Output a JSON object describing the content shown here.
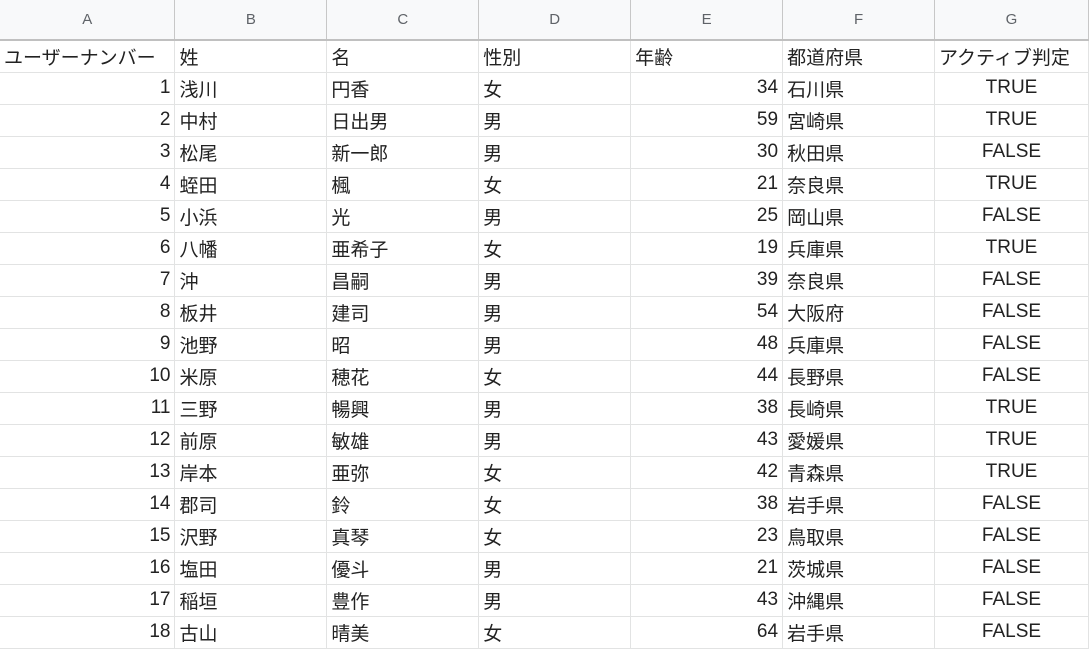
{
  "column_letters": [
    "A",
    "B",
    "C",
    "D",
    "E",
    "F",
    "G"
  ],
  "headers": [
    "ユーザーナンバー",
    "姓",
    "名",
    "性別",
    "年齢",
    "都道府県",
    "アクティブ判定"
  ],
  "rows": [
    [
      "1",
      "浅川",
      "円香",
      "女",
      "34",
      "石川県",
      "TRUE"
    ],
    [
      "2",
      "中村",
      "日出男",
      "男",
      "59",
      "宮崎県",
      "TRUE"
    ],
    [
      "3",
      "松尾",
      "新一郎",
      "男",
      "30",
      "秋田県",
      "FALSE"
    ],
    [
      "4",
      "蛭田",
      "楓",
      "女",
      "21",
      "奈良県",
      "TRUE"
    ],
    [
      "5",
      "小浜",
      "光",
      "男",
      "25",
      "岡山県",
      "FALSE"
    ],
    [
      "6",
      "八幡",
      "亜希子",
      "女",
      "19",
      "兵庫県",
      "TRUE"
    ],
    [
      "7",
      "沖",
      "昌嗣",
      "男",
      "39",
      "奈良県",
      "FALSE"
    ],
    [
      "8",
      "板井",
      "建司",
      "男",
      "54",
      "大阪府",
      "FALSE"
    ],
    [
      "9",
      "池野",
      "昭",
      "男",
      "48",
      "兵庫県",
      "FALSE"
    ],
    [
      "10",
      "米原",
      "穂花",
      "女",
      "44",
      "長野県",
      "FALSE"
    ],
    [
      "11",
      "三野",
      "暢興",
      "男",
      "38",
      "長崎県",
      "TRUE"
    ],
    [
      "12",
      "前原",
      "敏雄",
      "男",
      "43",
      "愛媛県",
      "TRUE"
    ],
    [
      "13",
      "岸本",
      "亜弥",
      "女",
      "42",
      "青森県",
      "TRUE"
    ],
    [
      "14",
      "郡司",
      "鈴",
      "女",
      "38",
      "岩手県",
      "FALSE"
    ],
    [
      "15",
      "沢野",
      "真琴",
      "女",
      "23",
      "鳥取県",
      "FALSE"
    ],
    [
      "16",
      "塩田",
      "優斗",
      "男",
      "21",
      "茨城県",
      "FALSE"
    ],
    [
      "17",
      "稲垣",
      "豊作",
      "男",
      "43",
      "沖縄県",
      "FALSE"
    ],
    [
      "18",
      "古山",
      "晴美",
      "女",
      "64",
      "岩手県",
      "FALSE"
    ]
  ]
}
